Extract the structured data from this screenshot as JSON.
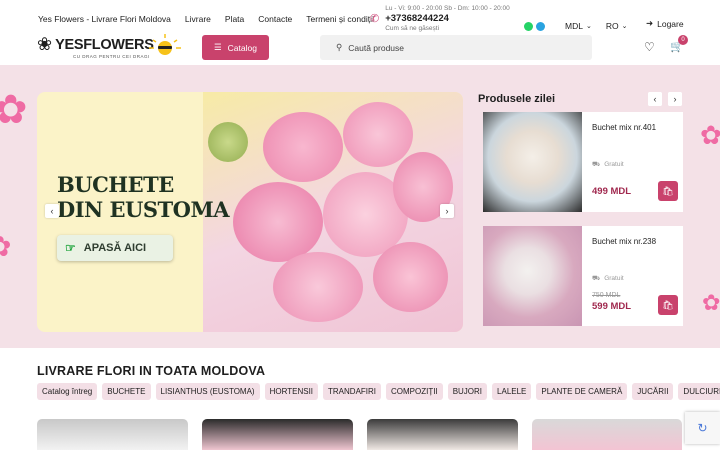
{
  "colors": {
    "accent": "#c9426c",
    "band": "#f4e1e7",
    "price": "#a0284e",
    "chip": "#f3dfe6"
  },
  "topnav": [
    "Yes Flowers - Livrare Flori Moldova",
    "Livrare",
    "Plata",
    "Contacte",
    "Termeni și condiții"
  ],
  "contact": {
    "hours": "Lu - Vi: 9:00 - 20:00 Sb - Dm: 10:00 - 20:00",
    "phone": "+37368244224",
    "note": "Cum să ne găsești"
  },
  "messengers": [
    "whatsapp-icon",
    "telegram-icon"
  ],
  "currency": "MDL",
  "language": "RO",
  "login_label": "Logare",
  "logo": {
    "text": "YESFLOWERS",
    "tagline": "CU DRAG PENTRU CEI DRAGI"
  },
  "catalog_label": "Catalog",
  "search_placeholder": "Caută produse",
  "cart_count": "0",
  "banner": {
    "title_line1": "BUCHETE",
    "title_line2": "DIN EUSTOMA",
    "cta": "APASĂ AICI"
  },
  "products_title": "Produsele zilei",
  "products": [
    {
      "name": "Buchet mix nr.401",
      "shipping": "Gratuit",
      "old_price": "",
      "price": "499 MDL"
    },
    {
      "name": "Buchet mix nr.238",
      "shipping": "Gratuit",
      "old_price": "750 MDL",
      "price": "599 MDL"
    }
  ],
  "section_title": "LIVRARE FLORI IN TOATA MOLDOVA",
  "categories": [
    "Catalog întreg",
    "BUCHETE",
    "LISIANTHUS (EUSTOMA)",
    "HORTENSII",
    "TRANDAFIRI",
    "COMPOZIȚII",
    "BUJORI",
    "LALELE",
    "PLANTE DE CAMERĂ",
    "JUCĂRII",
    "DULCIURI Ș"
  ]
}
